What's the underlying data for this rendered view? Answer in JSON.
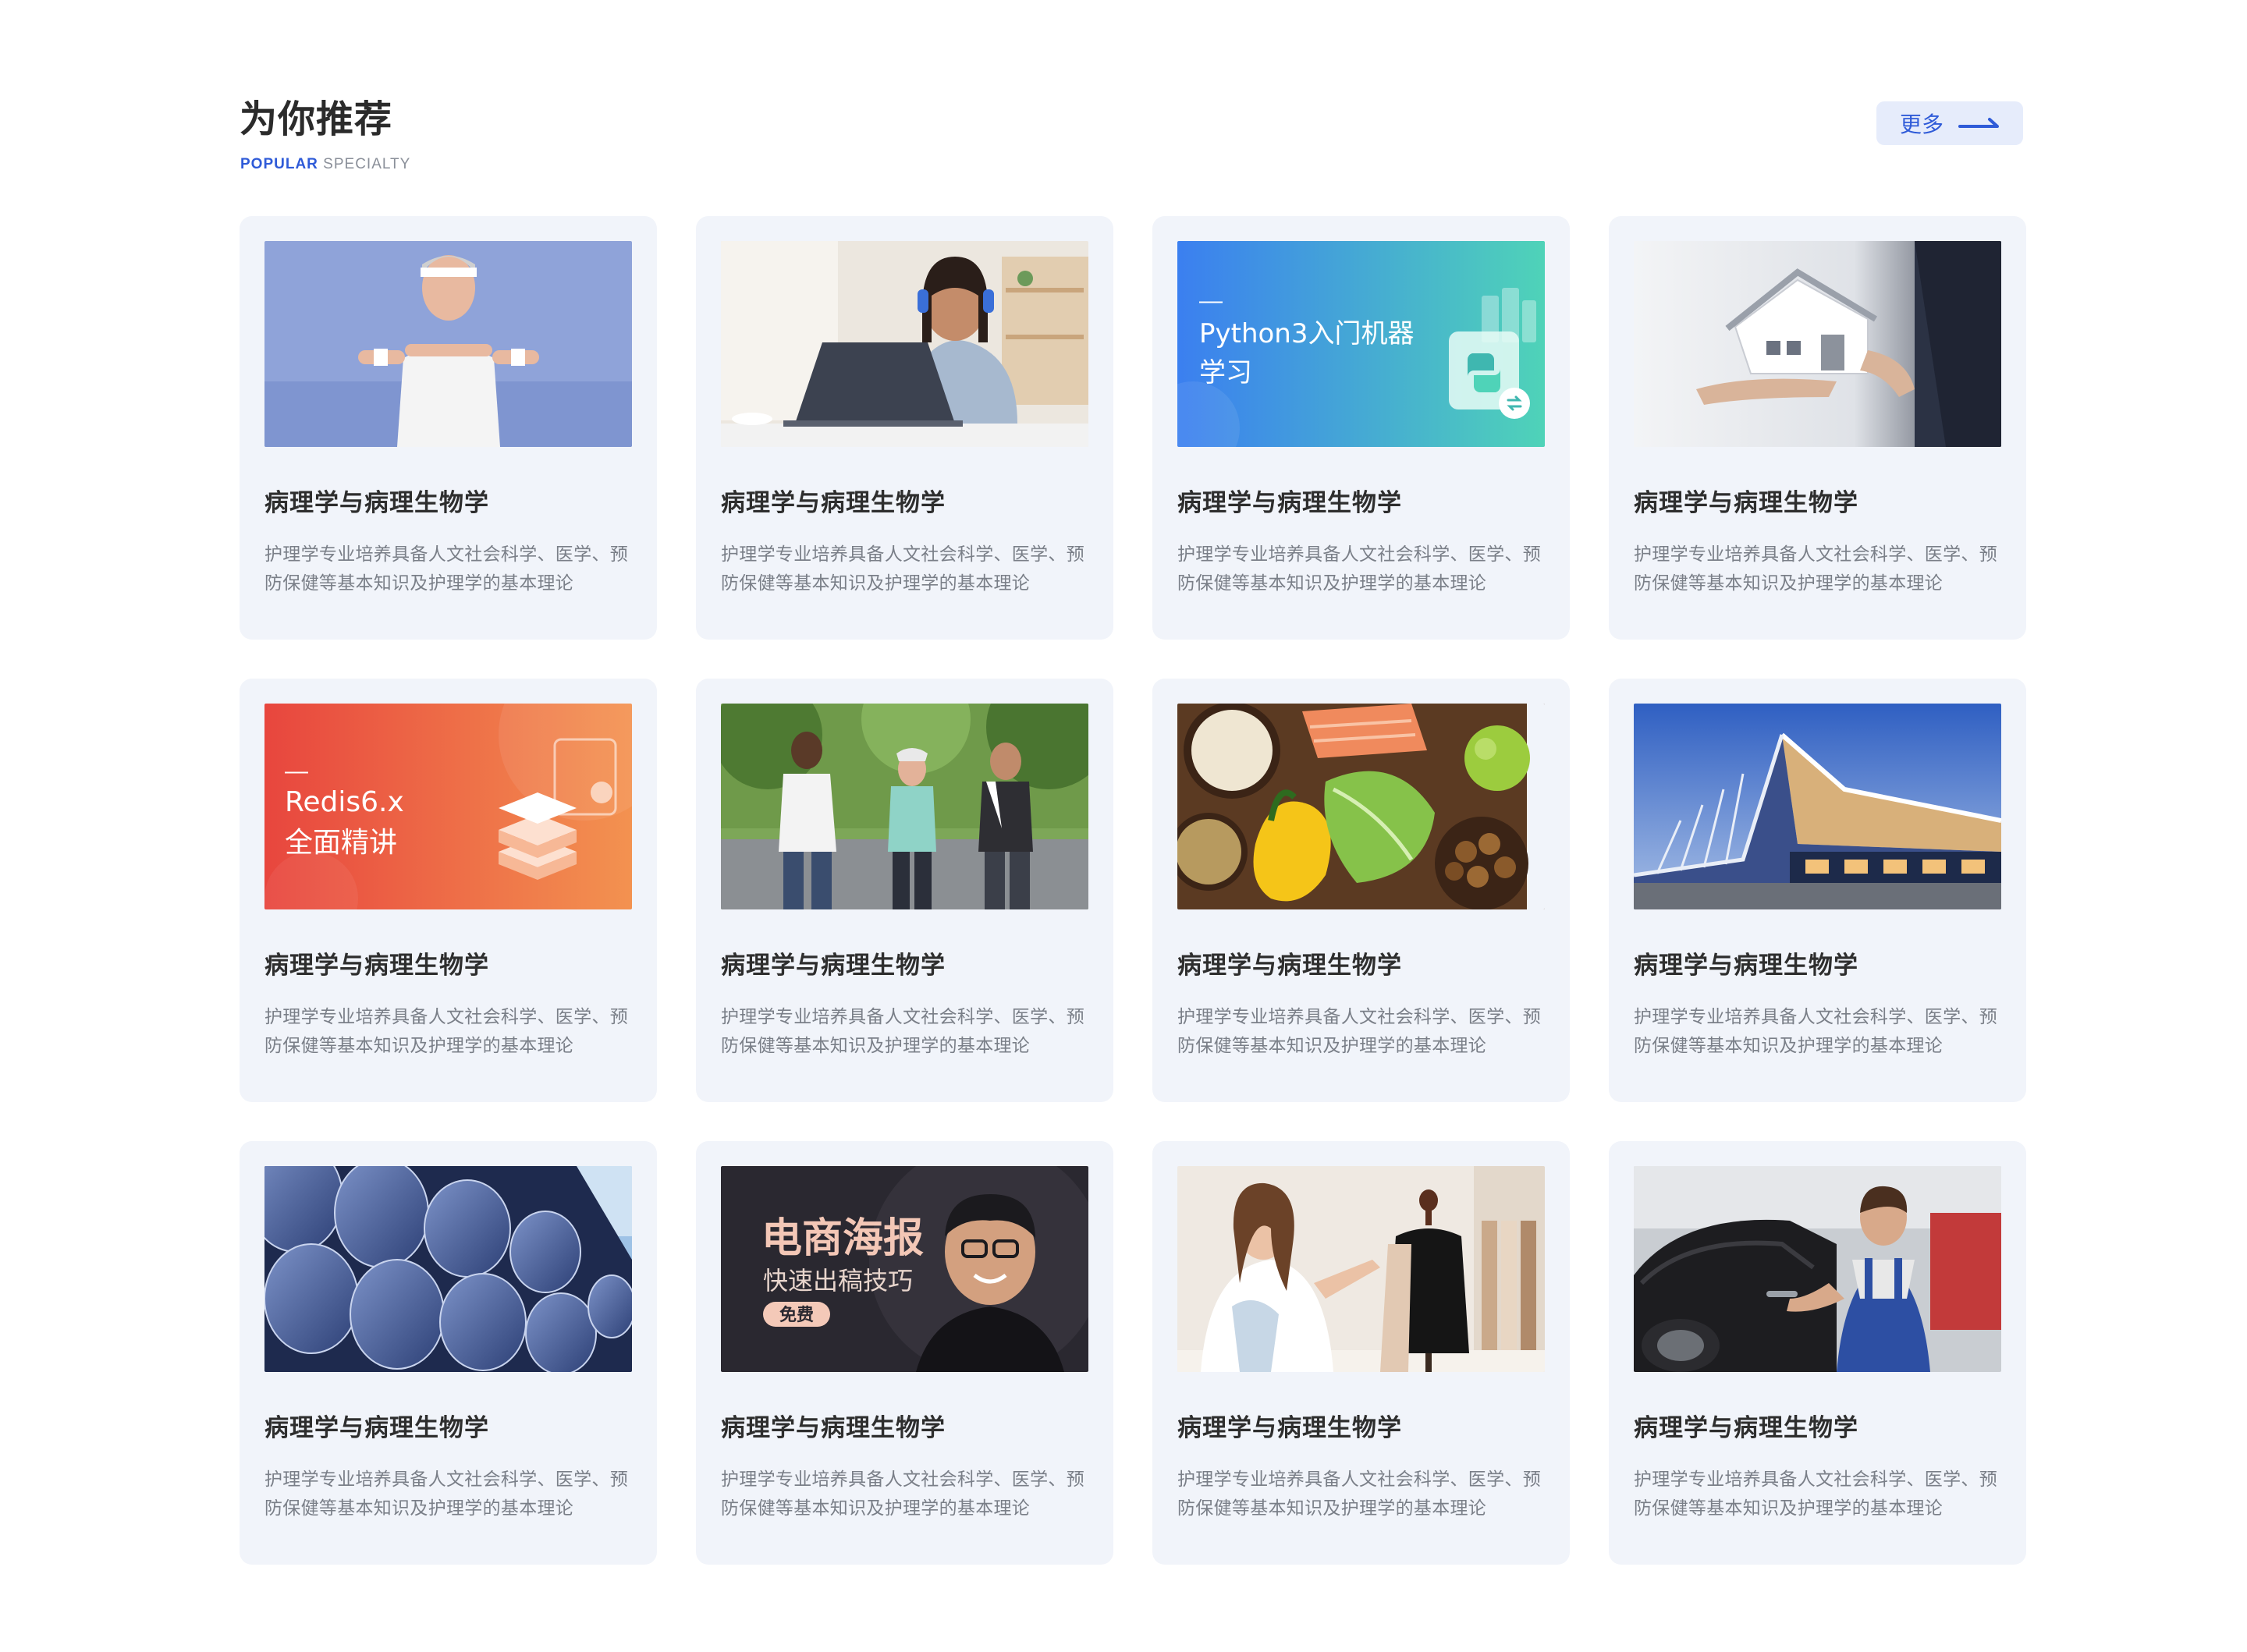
{
  "header": {
    "title": "为你推荐",
    "subtitle_highlight": "POPULAR",
    "subtitle_rest": " SPECIALTY",
    "more_label": "更多"
  },
  "colors": {
    "accent": "#2f5bd8",
    "card_bg": "#f1f4fa",
    "title": "#2e2e2e",
    "desc": "#7a7f88"
  },
  "cards": [
    {
      "image": "elderly-man-exercise-photo",
      "title": "病理学与病理生物学",
      "desc": "护理学专业培养具备人文社会科学、医学、预防保健等基本知识及护理学的基本理论"
    },
    {
      "image": "woman-laptop-headphones-photo",
      "title": "病理学与病理生物学",
      "desc": "护理学专业培养具备人文社会科学、医学、预防保健等基本知识及护理学的基本理论"
    },
    {
      "image": "python-course-banner",
      "banner_dash": "—",
      "banner_line1": "Python3入门机器",
      "banner_line2": "学习",
      "title": "病理学与病理生物学",
      "desc": "护理学专业培养具备人文社会科学、医学、预防保健等基本知识及护理学的基本理论"
    },
    {
      "image": "house-model-hands-photo",
      "title": "病理学与病理生物学",
      "desc": "护理学专业培养具备人文社会科学、医学、预防保健等基本知识及护理学的基本理论"
    },
    {
      "image": "redis-course-banner",
      "banner_dash": "—",
      "banner_line1": "Redis6.x",
      "banner_line2": "全面精讲",
      "title": "病理学与病理生物学",
      "desc": "护理学专业培养具备人文社会科学、医学、预防保健等基本知识及护理学的基本理论"
    },
    {
      "image": "seniors-jogging-photo",
      "title": "病理学与病理生物学",
      "desc": "护理学专业培养具备人文社会科学、医学、预防保健等基本知识及护理学的基本理论"
    },
    {
      "image": "healthy-food-photo",
      "title": "病理学与病理生物学",
      "desc": "护理学专业培养具备人文社会科学、医学、预防保健等基本知识及护理学的基本理论"
    },
    {
      "image": "modern-building-photo",
      "title": "病理学与病理生物学",
      "desc": "护理学专业培养具备人文社会科学、医学、预防保健等基本知识及护理学的基本理论"
    },
    {
      "image": "metal-rods-photo",
      "title": "病理学与病理生物学",
      "desc": "护理学专业培养具备人文社会科学、医学、预防保健等基本知识及护理学的基本理论"
    },
    {
      "image": "ecommerce-poster-banner",
      "banner_line1": "电商海报",
      "banner_line2": "快速出稿技巧",
      "banner_badge": "免费",
      "title": "病理学与病理生物学",
      "desc": "护理学专业培养具备人文社会科学、医学、预防保健等基本知识及护理学的基本理论"
    },
    {
      "image": "fashion-designer-photo",
      "title": "病理学与病理生物学",
      "desc": "护理学专业培养具备人文社会科学、医学、预防保健等基本知识及护理学的基本理论"
    },
    {
      "image": "mechanic-photo",
      "title": "病理学与病理生物学",
      "desc": "护理学专业培养具备人文社会科学、医学、预防保健等基本知识及护理学的基本理论"
    }
  ]
}
